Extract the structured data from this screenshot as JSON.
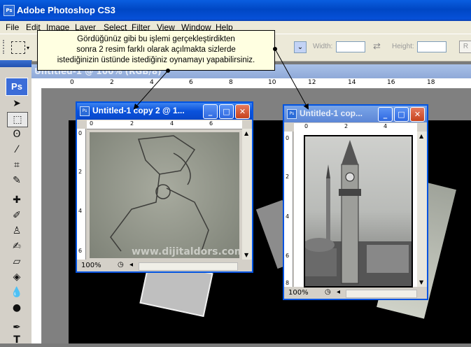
{
  "app": {
    "title": "Adobe Photoshop CS3",
    "icon": "Ps"
  },
  "menu": [
    "File",
    "Edit",
    "Image",
    "Layer",
    "Select",
    "Filter",
    "View",
    "Window",
    "Help"
  ],
  "options": {
    "width_label": "Width:",
    "height_label": "Height:",
    "refine_label": "R"
  },
  "tooltip": {
    "line1": "Gördüğünüz gibi bu işlemi gerçekleştirdikten",
    "line2": "sonra 2 resim farklı olarak açılmakta sizlerde",
    "line3": "istediğinizin üstünde istediğiniz oynamayı yapabilirsiniz."
  },
  "tools": {
    "logo": "Ps"
  },
  "main_doc": {
    "title": "Untitled-1 @ 100% (RGB/8)",
    "ruler": [
      "0",
      "2",
      "4",
      "6",
      "8",
      "10",
      "12",
      "14",
      "16",
      "18"
    ]
  },
  "window1": {
    "title": "Untitled-1 copy 2 @ 1...",
    "zoom": "100%",
    "ruler_h": [
      "0",
      "2",
      "4",
      "6"
    ],
    "ruler_v": [
      "0",
      "2",
      "4",
      "6"
    ],
    "watermark": "www.dijitaldors.com"
  },
  "window2": {
    "title": "Untitled-1 cop...",
    "zoom": "100%",
    "ruler_h": [
      "0",
      "2",
      "4"
    ],
    "ruler_v": [
      "0",
      "2",
      "4",
      "6",
      "8"
    ]
  },
  "colors": {
    "titlebar": "#0a5ee0",
    "window_border": "#0053e1",
    "tooltip_bg": "#ffffe1"
  }
}
